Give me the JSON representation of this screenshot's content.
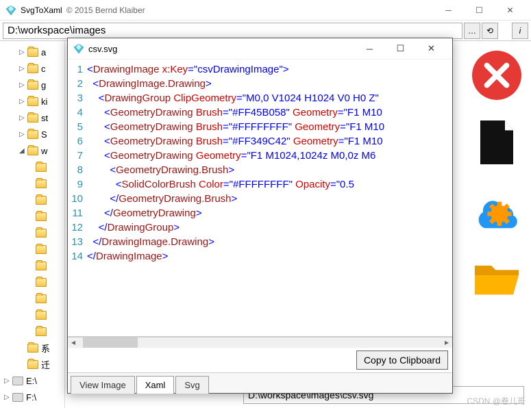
{
  "main": {
    "title": "SvgToXaml",
    "copyright": "© 2015 Bernd Klaiber",
    "path": "D:\\workspace\\images",
    "info_btn": "i"
  },
  "tree": {
    "items": [
      {
        "level": 2,
        "exp": "▷",
        "icon": "folder",
        "label": "a"
      },
      {
        "level": 2,
        "exp": "▷",
        "icon": "folder",
        "label": "c"
      },
      {
        "level": 2,
        "exp": "▷",
        "icon": "folder",
        "label": "g"
      },
      {
        "level": 2,
        "exp": "▷",
        "icon": "folder",
        "label": "ki"
      },
      {
        "level": 2,
        "exp": "▷",
        "icon": "folder",
        "label": "st"
      },
      {
        "level": 2,
        "exp": "▷",
        "icon": "folder",
        "label": "S"
      },
      {
        "level": 2,
        "exp": "◢",
        "icon": "folder",
        "label": "w"
      },
      {
        "level": 3,
        "exp": "",
        "icon": "folder",
        "label": ""
      },
      {
        "level": 3,
        "exp": "",
        "icon": "folder",
        "label": ""
      },
      {
        "level": 3,
        "exp": "",
        "icon": "folder",
        "label": ""
      },
      {
        "level": 3,
        "exp": "",
        "icon": "folder",
        "label": ""
      },
      {
        "level": 3,
        "exp": "",
        "icon": "folder",
        "label": ""
      },
      {
        "level": 3,
        "exp": "",
        "icon": "folder",
        "label": ""
      },
      {
        "level": 3,
        "exp": "",
        "icon": "folder",
        "label": ""
      },
      {
        "level": 3,
        "exp": "",
        "icon": "folder",
        "label": ""
      },
      {
        "level": 3,
        "exp": "",
        "icon": "folder",
        "label": ""
      },
      {
        "level": 3,
        "exp": "",
        "icon": "folder",
        "label": ""
      },
      {
        "level": 3,
        "exp": "",
        "icon": "folder",
        "label": ""
      },
      {
        "level": 2,
        "exp": "",
        "icon": "folder",
        "label": "系"
      },
      {
        "level": 2,
        "exp": "",
        "icon": "folder",
        "label": "迁"
      },
      {
        "level": 1,
        "exp": "▷",
        "icon": "drive",
        "label": "E:\\"
      },
      {
        "level": 1,
        "exp": "▷",
        "icon": "drive",
        "label": "F:\\"
      }
    ]
  },
  "popup": {
    "title": "csv.svg",
    "copy_label": "Copy to Clipboard",
    "tabs": [
      "View Image",
      "Xaml",
      "Svg"
    ],
    "active_tab": 1,
    "code": [
      {
        "n": 1,
        "html": "<span class='c-blue'>&lt;</span><span class='c-maroon'>DrawingImage</span> <span class='c-red'>x:Key</span><span class='c-blue'>=\"csvDrawingImage\"&gt;</span>"
      },
      {
        "n": 2,
        "html": "  <span class='c-blue'>&lt;</span><span class='c-maroon'>DrawingImage.Drawing</span><span class='c-blue'>&gt;</span>"
      },
      {
        "n": 3,
        "html": "    <span class='c-blue'>&lt;</span><span class='c-maroon'>DrawingGroup</span> <span class='c-red'>ClipGeometry</span><span class='c-blue'>=\"M0,0 V1024 H1024 V0 H0 Z\"</span>"
      },
      {
        "n": 4,
        "html": "      <span class='c-blue'>&lt;</span><span class='c-maroon'>GeometryDrawing</span> <span class='c-red'>Brush</span><span class='c-blue'>=\"#FF45B058\"</span> <span class='c-red'>Geometry</span><span class='c-blue'>=\"F1 M10</span>"
      },
      {
        "n": 5,
        "html": "      <span class='c-blue'>&lt;</span><span class='c-maroon'>GeometryDrawing</span> <span class='c-red'>Brush</span><span class='c-blue'>=\"#FFFFFFFF\"</span> <span class='c-red'>Geometry</span><span class='c-blue'>=\"F1 M10</span>"
      },
      {
        "n": 6,
        "html": "      <span class='c-blue'>&lt;</span><span class='c-maroon'>GeometryDrawing</span> <span class='c-red'>Brush</span><span class='c-blue'>=\"#FF349C42\"</span> <span class='c-red'>Geometry</span><span class='c-blue'>=\"F1 M10</span>"
      },
      {
        "n": 7,
        "html": "      <span class='c-blue'>&lt;</span><span class='c-maroon'>GeometryDrawing</span> <span class='c-red'>Geometry</span><span class='c-blue'>=\"F1 M1024,1024z M0,0z M6</span>"
      },
      {
        "n": 8,
        "html": "        <span class='c-blue'>&lt;</span><span class='c-maroon'>GeometryDrawing.Brush</span><span class='c-blue'>&gt;</span>"
      },
      {
        "n": 9,
        "html": "          <span class='c-blue'>&lt;</span><span class='c-maroon'>SolidColorBrush</span> <span class='c-red'>Color</span><span class='c-blue'>=\"#FFFFFFFF\"</span> <span class='c-red'>Opacity</span><span class='c-blue'>=\"0.5</span>"
      },
      {
        "n": 10,
        "html": "        <span class='c-blue'>&lt;/</span><span class='c-maroon'>GeometryDrawing.Brush</span><span class='c-blue'>&gt;</span>"
      },
      {
        "n": 11,
        "html": "      <span class='c-blue'>&lt;/</span><span class='c-maroon'>GeometryDrawing</span><span class='c-blue'>&gt;</span>"
      },
      {
        "n": 12,
        "html": "    <span class='c-blue'>&lt;/</span><span class='c-maroon'>DrawingGroup</span><span class='c-blue'>&gt;</span>"
      },
      {
        "n": 13,
        "html": "  <span class='c-blue'>&lt;/</span><span class='c-maroon'>DrawingImage.Drawing</span><span class='c-blue'>&gt;</span>"
      },
      {
        "n": 14,
        "html": "<span class='c-blue'>&lt;/</span><span class='c-maroon'>DrawingImage</span><span class='c-blue'>&gt;</span>"
      }
    ]
  },
  "status": {
    "path": "D:\\workspace\\images\\csv.svg"
  },
  "watermark": "CSDN @卷儿哥"
}
